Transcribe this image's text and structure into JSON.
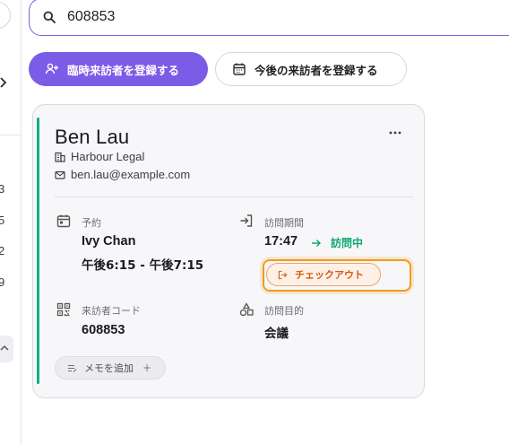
{
  "sidebar": {
    "numbers": [
      "3",
      "5",
      "2",
      "9"
    ]
  },
  "search": {
    "value": "608853",
    "icon": "search-icon"
  },
  "actions": {
    "register_temporary_label": "臨時来訪者を登録する",
    "register_future_label": "今後の来訪者を登録する"
  },
  "visitor": {
    "name": "Ben Lau",
    "company": "Harbour Legal",
    "email": "ben.lau@example.com",
    "reservation": {
      "label": "予約",
      "host": "Ivy Chan",
      "time": "午後6:15 - 午後7:15"
    },
    "visit_period": {
      "label": "訪問期間",
      "start": "17:47",
      "status": "訪問中"
    },
    "checkout_label": "チェックアウト",
    "visitor_code": {
      "label": "来訪者コード",
      "value": "608853"
    },
    "purpose": {
      "label": "訪問目的",
      "value": "会議"
    },
    "memo_label": "メモを追加",
    "memo_plus": "+"
  },
  "colors": {
    "accent": "#7b5ce6",
    "active_green": "#10b17d",
    "checkout_orange": "#d45a12",
    "highlight_ring": "#f29a1a"
  }
}
